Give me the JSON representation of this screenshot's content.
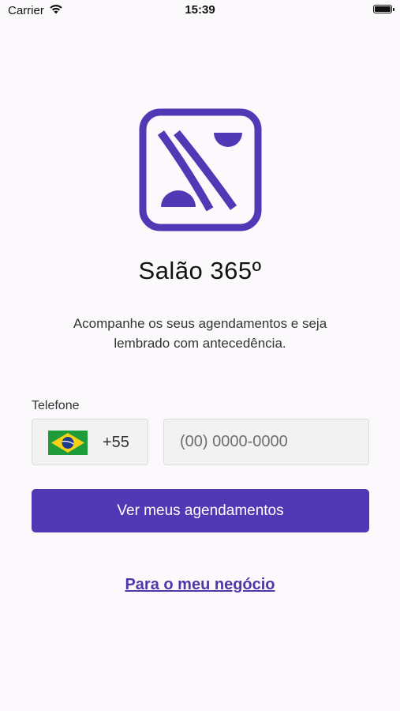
{
  "status_bar": {
    "carrier": "Carrier",
    "time": "15:39"
  },
  "app": {
    "title": "Salão 365º",
    "subtitle": "Acompanhe os seus agendamentos e seja lembrado com antecedência.",
    "brand_color": "#5138b4"
  },
  "form": {
    "phone_label": "Telefone",
    "country_flag": "brazil-flag-icon",
    "country_code": "+55",
    "phone_value": "",
    "phone_placeholder": "(00) 0000-0000",
    "submit_label": "Ver meus agendamentos"
  },
  "links": {
    "business_label": "Para o meu negócio"
  }
}
